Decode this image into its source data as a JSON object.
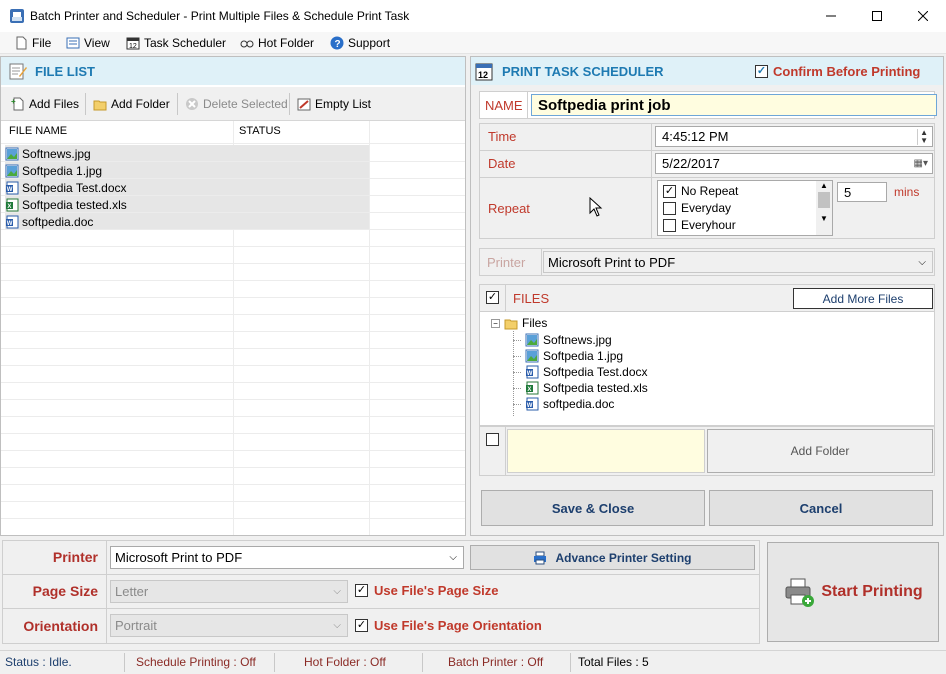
{
  "window": {
    "title": "Batch Printer and Scheduler - Print Multiple Files & Schedule Print Task"
  },
  "menu": [
    "File",
    "View",
    "Task Scheduler",
    "Hot Folder",
    "Support"
  ],
  "file_list": {
    "header": "FILE LIST",
    "toolbar": {
      "add_files": "Add Files",
      "add_folder": "Add Folder",
      "delete_selected": "Delete Selected",
      "empty_list": "Empty List"
    },
    "columns": [
      "FILE NAME",
      "STATUS"
    ],
    "files": [
      {
        "name": "Softnews.jpg",
        "type": "image"
      },
      {
        "name": "Softpedia 1.jpg",
        "type": "image"
      },
      {
        "name": "Softpedia Test.docx",
        "type": "word"
      },
      {
        "name": "Softpedia tested.xls",
        "type": "excel"
      },
      {
        "name": "softpedia.doc",
        "type": "word"
      }
    ]
  },
  "scheduler": {
    "header": "PRINT TASK SCHEDULER",
    "confirm_label": "Confirm Before Printing",
    "name_label": "NAME",
    "name_value": "Softpedia print job",
    "time_label": "Time",
    "time_value": "4:45:12 PM",
    "date_label": "Date",
    "date_value": "5/22/2017",
    "repeat_label": "Repeat",
    "repeat_options": [
      {
        "label": "No Repeat",
        "checked": true
      },
      {
        "label": "Everyday",
        "checked": false
      },
      {
        "label": "Everyhour",
        "checked": false
      }
    ],
    "mins_value": "5",
    "mins_label": "mins",
    "printer_label": "Printer",
    "printer_value": "Microsoft Print to PDF",
    "files_label": "FILES",
    "add_more_files": "Add More Files",
    "tree_root": "Files",
    "tree_files": [
      {
        "name": "Softnews.jpg",
        "type": "image"
      },
      {
        "name": "Softpedia 1.jpg",
        "type": "image"
      },
      {
        "name": "Softpedia Test.docx",
        "type": "word"
      },
      {
        "name": "Softpedia tested.xls",
        "type": "excel"
      },
      {
        "name": "softpedia.doc",
        "type": "word"
      }
    ],
    "add_folder": "Add Folder",
    "save_close": "Save & Close",
    "cancel": "Cancel"
  },
  "bottom": {
    "printer_label": "Printer",
    "printer_value": "Microsoft Print to PDF",
    "advance_setting": "Advance Printer Setting",
    "page_size_label": "Page Size",
    "page_size_value": "Letter",
    "use_page_size": "Use File's Page Size",
    "orientation_label": "Orientation",
    "orientation_value": "Portrait",
    "use_orientation": "Use File's Page Orientation",
    "start_printing": "Start Printing"
  },
  "status": {
    "status": "Status :  Idle.",
    "schedule": "Schedule Printing : Off",
    "hot_folder": "Hot Folder : Off",
    "batch": "Batch Printer : Off",
    "total": "Total Files :   5"
  },
  "colors": {
    "header_bg": "#dff1f8",
    "header_text": "#1e7ab2",
    "label_red": "#c0392b",
    "name_bg": "#fffde0"
  }
}
